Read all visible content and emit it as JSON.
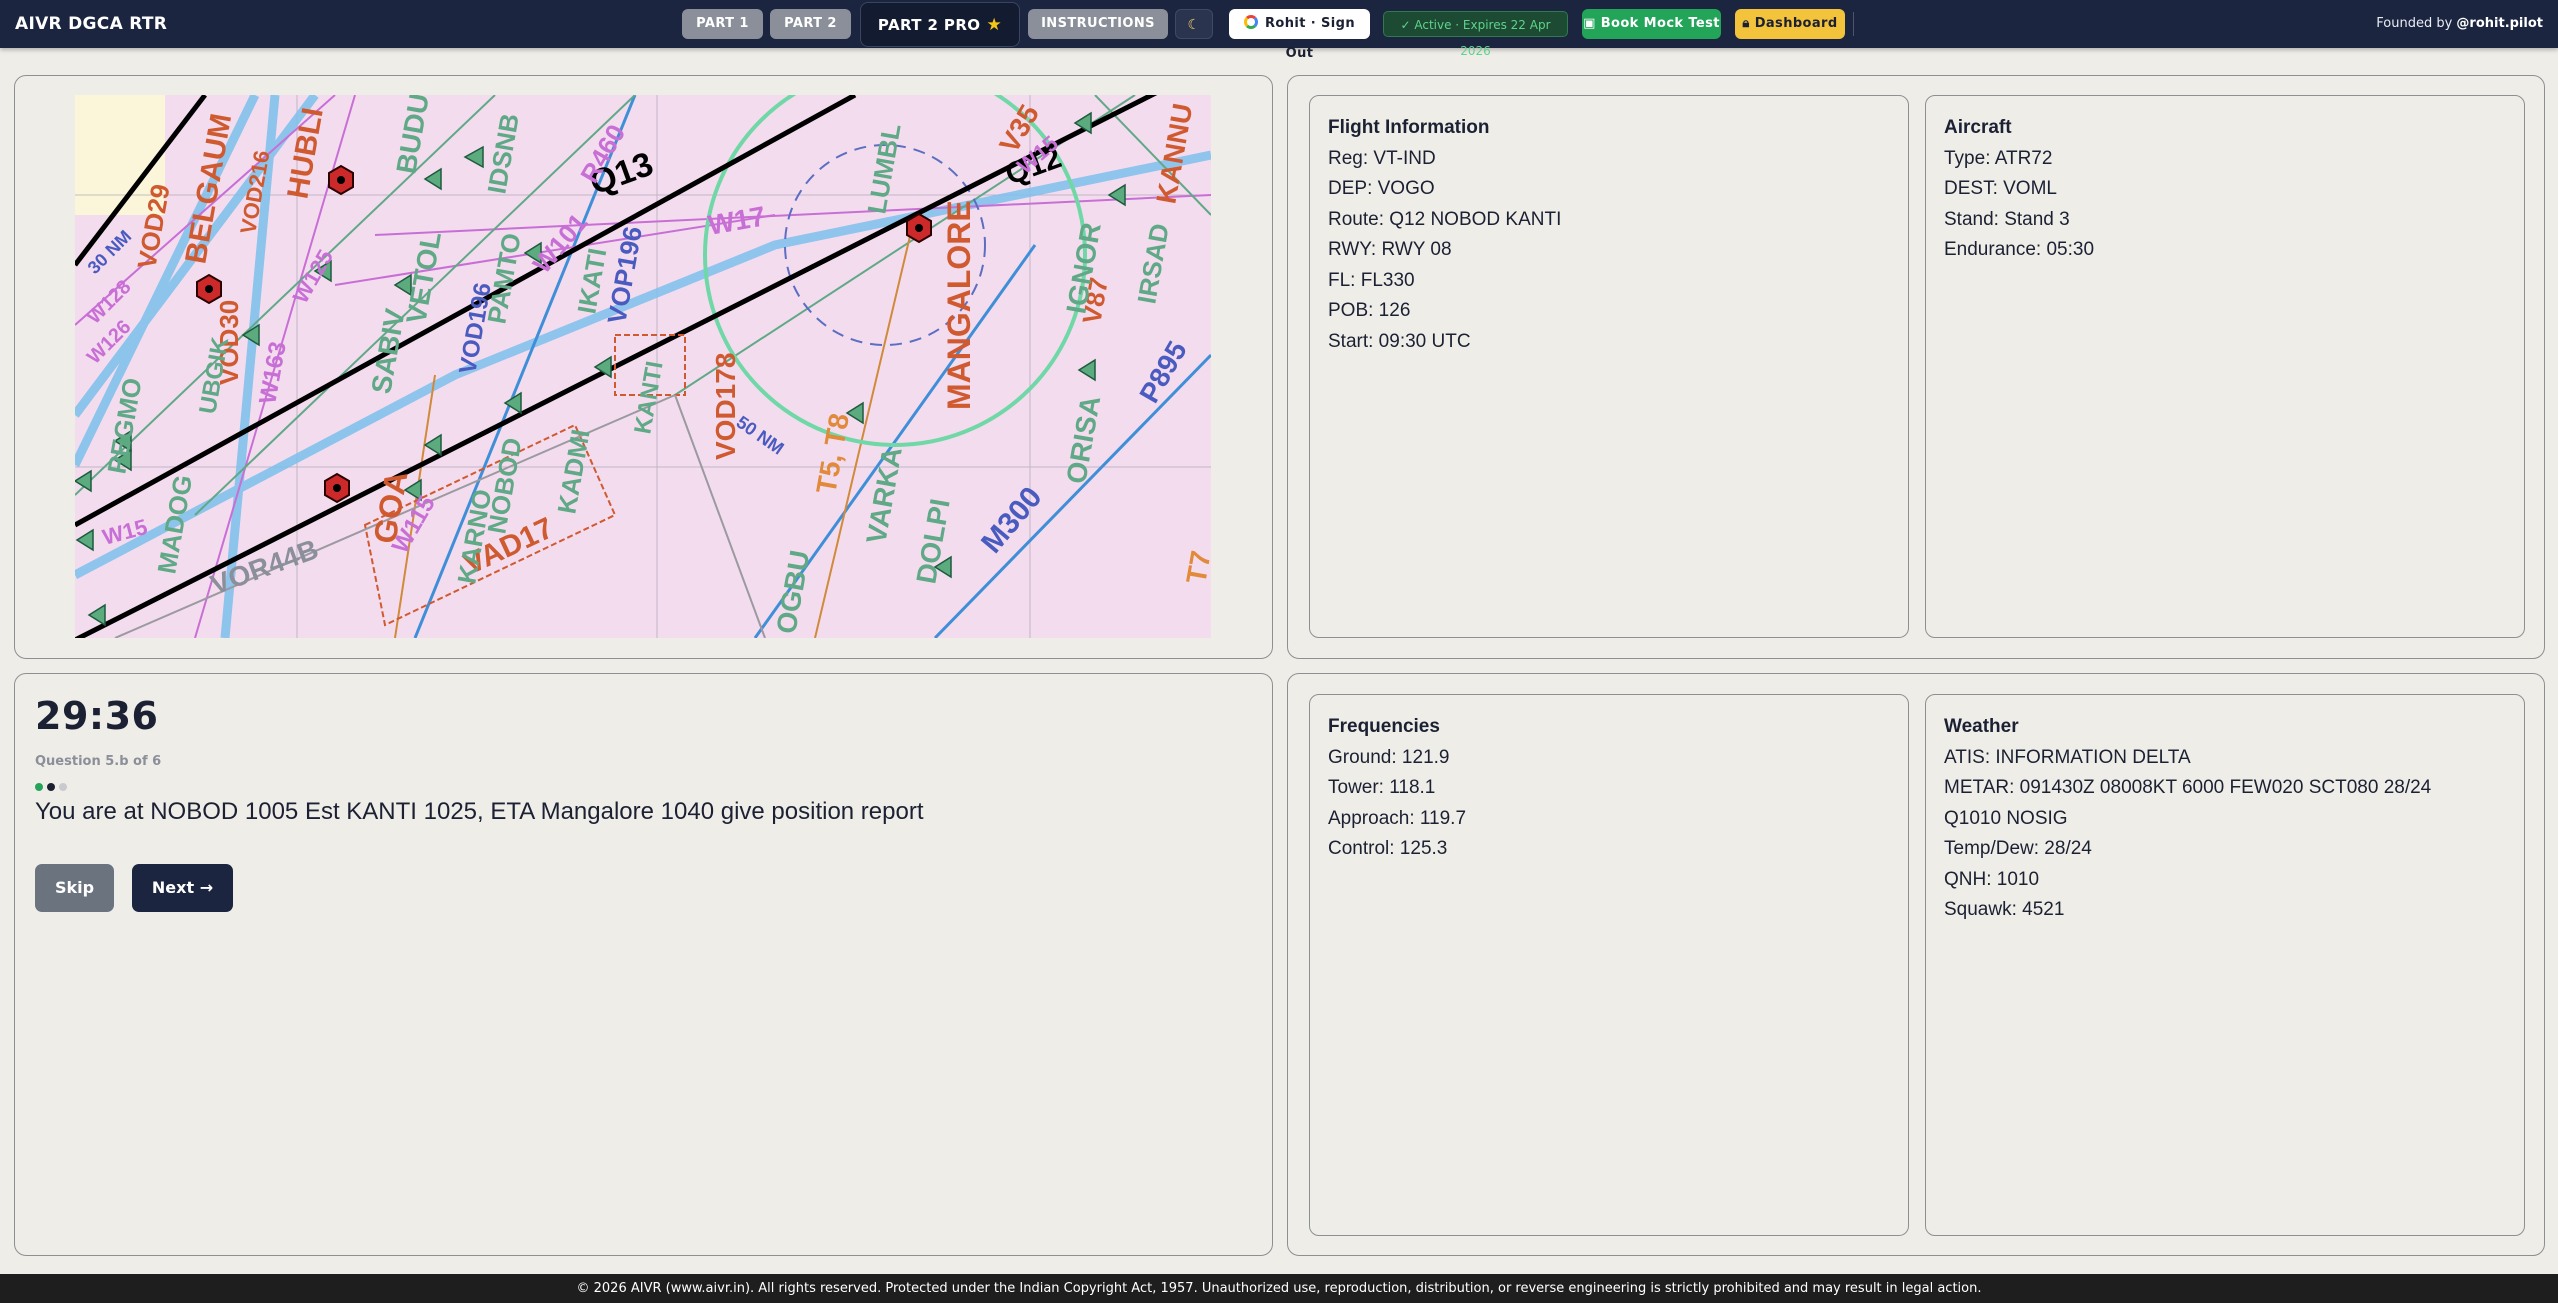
{
  "app": {
    "title": "AIVR DGCA RTR"
  },
  "nav": {
    "part1": "PART 1",
    "part2": "PART 2",
    "part2_pro": "PART 2 PRO",
    "instructions": "INSTRUCTIONS",
    "theme_toggle_icon": "moon-icon",
    "signout": "Rohit · Sign Out",
    "status": "✓ Active · Expires 22 Apr 2026",
    "book_mock": "Book Mock Test",
    "dashboard": "Dashboard",
    "founded_prefix": "Founded by",
    "founded_handle": "@rohit.pilot"
  },
  "colors": {
    "topbar": "#1b2540",
    "accent_green": "#22a559",
    "accent_yellow": "#f3c33b",
    "background": "#efede8"
  },
  "map": {
    "labels": [
      "BELGAUM",
      "HUBLI",
      "VOD29",
      "VOD216",
      "W128",
      "W126",
      "W125",
      "W163",
      "VOD30",
      "UBGIK",
      "SABIV",
      "VETOL",
      "BUDU",
      "IDSNB",
      "W101",
      "R460",
      "VOD196",
      "VOP196",
      "PAMTO",
      "IKATI",
      "Q13",
      "Q12",
      "W17",
      "W15",
      "LUMBL",
      "MANGALORE",
      "V87",
      "IGNOR",
      "IRSAD",
      "KANNU",
      "P895",
      "PEGMO",
      "MADOG",
      "VOR44B",
      "GOA",
      "KARNO",
      "NOBOD",
      "KADMI",
      "KANTI",
      "VAD17",
      "VOD178",
      "T5, T8",
      "VARKA",
      "DOLPI",
      "OGBU",
      "M300",
      "ORISA",
      "W115",
      "30 NM",
      "50 NM",
      "T7",
      "V35",
      "W15"
    ]
  },
  "question": {
    "timer": "29:36",
    "counter": "Question 5.b of 6",
    "text": "You are at NOBOD 1005 Est KANTI 1025, ETA Mangalore 1040 give position report",
    "skip": "Skip",
    "next": "Next →"
  },
  "flight_info": {
    "title": "Flight Information",
    "lines": [
      "Reg: VT-IND",
      "DEP: VOGO",
      "Route: Q12 NOBOD KANTI",
      "RWY: RWY 08",
      "FL: FL330",
      "POB: 126",
      "Start: 09:30 UTC"
    ]
  },
  "aircraft": {
    "title": "Aircraft",
    "lines": [
      "Type: ATR72",
      "DEST: VOML",
      "Stand: Stand 3",
      "Endurance: 05:30"
    ]
  },
  "frequencies": {
    "title": "Frequencies",
    "lines": [
      "Ground: 121.9",
      "Tower: 118.1",
      "Approach: 119.7",
      "Control: 125.3"
    ]
  },
  "weather": {
    "title": "Weather",
    "lines": [
      "ATIS: INFORMATION DELTA",
      "METAR: 091430Z 08008KT 6000 FEW020 SCT080 28/24",
      "Q1010 NOSIG",
      "Temp/Dew: 28/24",
      "QNH: 1010",
      "Squawk: 4521"
    ]
  },
  "footer": {
    "text": "© 2026 AIVR (www.aivr.in). All rights reserved. Protected under the Indian Copyright Act, 1957. Unauthorized use, reproduction, distribution, or reverse engineering is strictly prohibited and may result in legal action."
  }
}
